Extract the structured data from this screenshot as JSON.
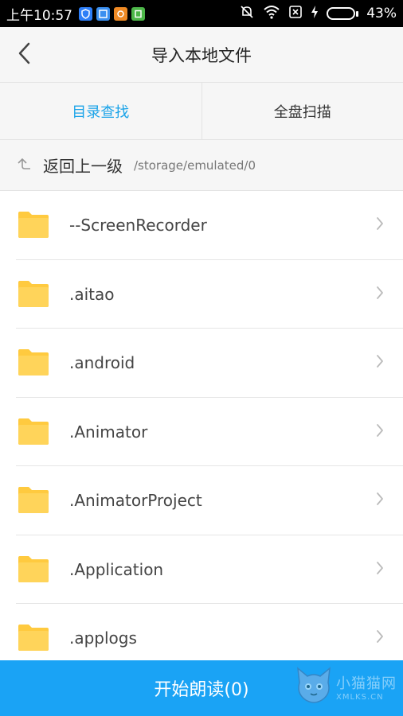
{
  "status_bar": {
    "time": "上午10:57",
    "battery_percent_label": "43%",
    "battery_level": 0.43,
    "icons": [
      "shield-icon",
      "app-icon",
      "app-icon",
      "app-icon",
      "mute-icon",
      "wifi-icon",
      "no-sim-icon",
      "charging-icon",
      "battery-icon"
    ]
  },
  "header": {
    "title": "导入本地文件"
  },
  "tabs": [
    {
      "label": "目录查找",
      "active": true
    },
    {
      "label": "全盘扫描",
      "active": false
    }
  ],
  "navigation": {
    "up_label": "返回上一级",
    "current_path": "/storage/emulated/0"
  },
  "files": [
    {
      "name": "--ScreenRecorder",
      "type": "folder"
    },
    {
      "name": ".aitao",
      "type": "folder"
    },
    {
      "name": ".android",
      "type": "folder"
    },
    {
      "name": ".Animator",
      "type": "folder"
    },
    {
      "name": ".AnimatorProject",
      "type": "folder"
    },
    {
      "name": ".Application",
      "type": "folder"
    },
    {
      "name": ".applogs",
      "type": "folder"
    }
  ],
  "footer": {
    "action_label": "开始朗读(0)"
  },
  "watermark": {
    "text": "小猫猫网",
    "subtext": "XMLKS.CN"
  },
  "colors": {
    "accent": "#1aa3e8",
    "footer": "#1aa3f5",
    "folder": "#ffca3f"
  }
}
